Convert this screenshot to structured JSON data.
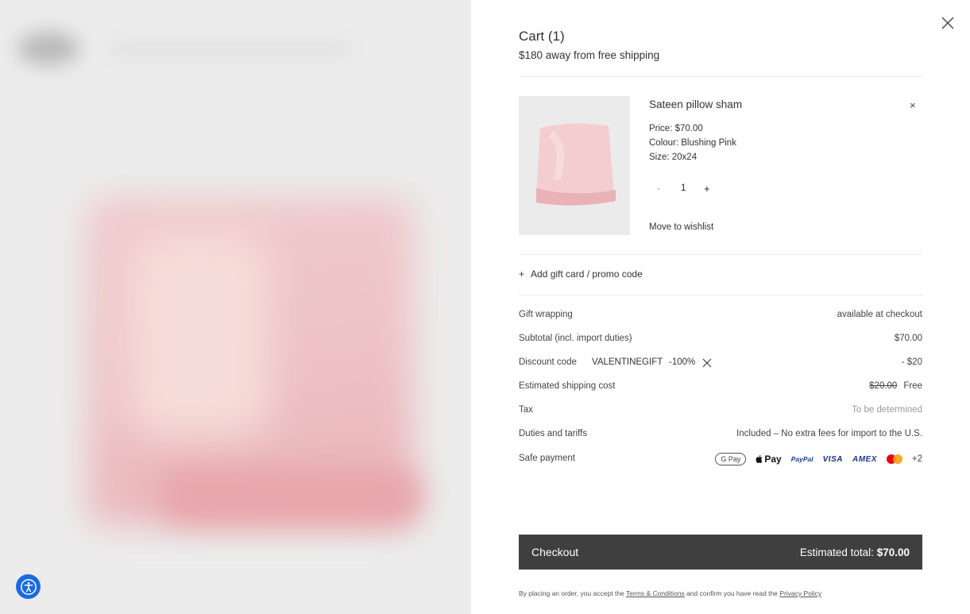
{
  "cart": {
    "title": "Cart (1)",
    "shipping_note": "$180 away from free shipping"
  },
  "item": {
    "name": "Sateen pillow sham",
    "price": "Price: $70.00",
    "colour": "Colour: Blushing Pink",
    "size": "Size: 20x24",
    "quantity": "1",
    "qty_minus": "-",
    "qty_plus": "+",
    "remove": "×",
    "wishlist": "Move to wishlist"
  },
  "promo": {
    "plus": "+",
    "label": "Add gift card / promo code"
  },
  "summary": {
    "gift_label": "Gift wrapping",
    "gift_value": "available at checkout",
    "subtotal_label": "Subtotal (incl. import duties)",
    "subtotal_value": "$70.00",
    "discount_label": "Discount code",
    "discount_code": "VALENTINEGIFT",
    "discount_pct": "-100%",
    "discount_value": "- $20",
    "shipping_label": "Estimated shipping cost",
    "shipping_old": "$20.00",
    "shipping_value": "Free",
    "tax_label": "Tax",
    "tax_value": "To be determined",
    "duties_label": "Duties and tariffs",
    "duties_value": "Included – No extra fees for import to the U.S.",
    "payment_label": "Safe payment"
  },
  "payments": {
    "gpay": "G Pay",
    "applepay": "Pay",
    "paypal": "PayPal",
    "visa": "VISA",
    "amex": "AMEX",
    "more": "+2"
  },
  "checkout": {
    "label": "Checkout",
    "total_label": "Estimated total:",
    "total_value": "$70.00"
  },
  "legal": {
    "prefix": "By placing an order, you accept the",
    "terms": "Terms & Conditions",
    "middle": "and confirm you have read the",
    "privacy": "Privacy Policy"
  },
  "colors": {
    "checkout_bg": "#3f3f3f",
    "a11y_blue": "#1a6be0",
    "product_pink": "#f0c4c8"
  }
}
